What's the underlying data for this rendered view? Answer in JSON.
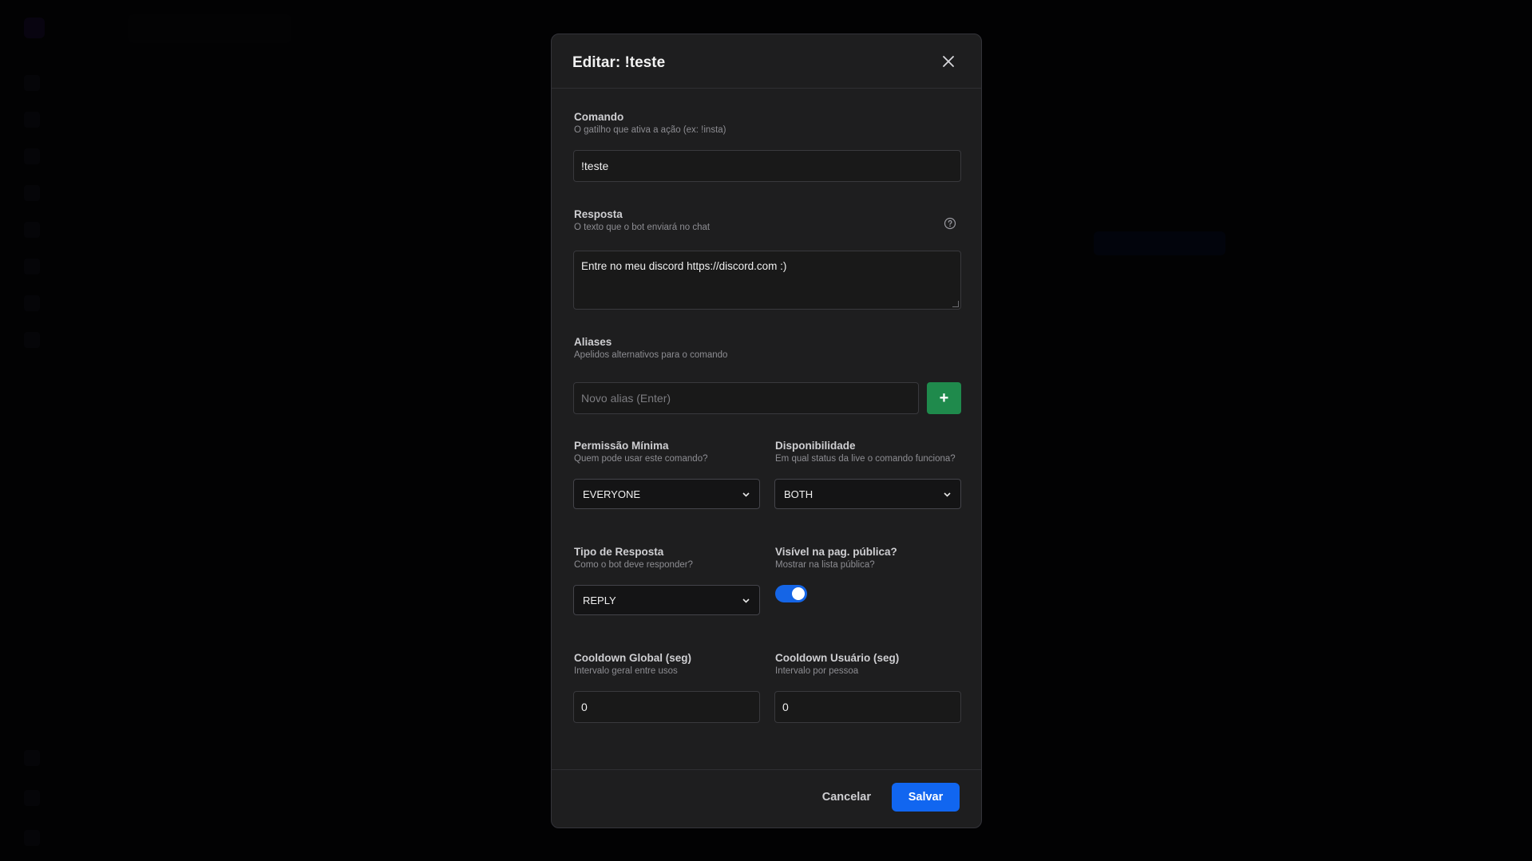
{
  "modal": {
    "title": "Editar: !teste",
    "command": {
      "label": "Comando",
      "description": "O gatilho que ativa a ação (ex: !insta)",
      "value": "!teste"
    },
    "response": {
      "label": "Resposta",
      "description": "O texto que o bot enviará no chat",
      "value": "Entre no meu discord https://discord.com :)",
      "help_icon": "question-circle-icon"
    },
    "aliases": {
      "label": "Aliases",
      "description": "Apelidos alternativos para o comando",
      "placeholder": "Novo alias (Enter)",
      "add_label": "+"
    },
    "permission": {
      "label": "Permissão Mínima",
      "description": "Quem pode usar este comando?",
      "selected": "EVERYONE"
    },
    "availability": {
      "label": "Disponibilidade",
      "description": "Em qual status da live o comando funciona?",
      "selected": "BOTH"
    },
    "response_type": {
      "label": "Tipo de Resposta",
      "description": "Como o bot deve responder?",
      "selected": "REPLY"
    },
    "public_visibility": {
      "label": "Visível na pag. pública?",
      "description": "Mostrar na lista pública?",
      "enabled": true
    },
    "cooldown_global": {
      "label": "Cooldown Global (seg)",
      "description": "Intervalo geral entre usos",
      "value": "0"
    },
    "cooldown_user": {
      "label": "Cooldown Usuário (seg)",
      "description": "Intervalo por pessoa",
      "value": "0"
    },
    "footer": {
      "cancel_label": "Cancelar",
      "save_label": "Salvar"
    }
  },
  "colors": {
    "modal_bg": "#1e1e1f",
    "accent_blue": "#1166f0",
    "add_green": "#1f8a4c",
    "toggle_on": "#1565e6"
  }
}
